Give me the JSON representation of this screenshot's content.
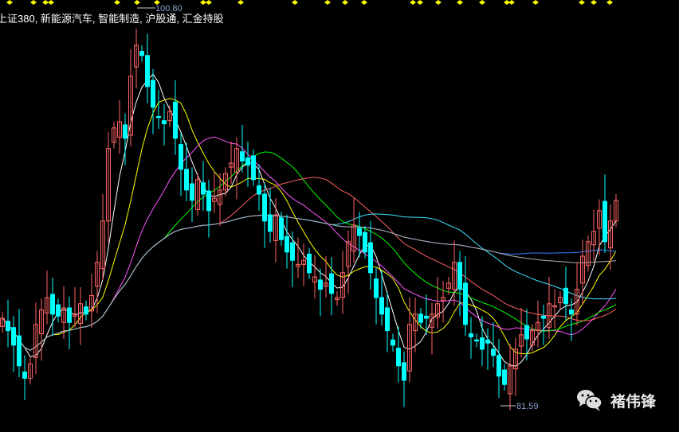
{
  "header": {
    "concepts": "上证380, 新能源汽车, 智能制造, 沪股通, 汇金持股"
  },
  "watermark": {
    "name": "褚伟锋",
    "icon": "wechat-icon"
  },
  "colors": {
    "up": "#ff6464",
    "down": "#00ffff",
    "background": "#000000",
    "marker": "#ffff00"
  },
  "chart_data": {
    "type": "candlestick",
    "title": "上证380, 新能源汽车, 智能制造, 沪股通, 汇金持股",
    "high_label": "100.80",
    "low_label": "81.59",
    "ylim": [
      81.0,
      101.2
    ],
    "close": [
      85.8,
      85.2,
      84.5,
      83.5,
      82.9,
      83.6,
      85.5,
      86.2,
      86.8,
      86.0,
      85.9,
      86.3,
      85.6,
      86.0,
      86.5,
      86.0,
      86.9,
      88.5,
      90.5,
      94.0,
      95.0,
      95.3,
      94.5,
      97.5,
      99.0,
      98.5,
      97.0,
      96.0,
      95.5,
      95.2,
      95.8,
      94.5,
      93.0,
      92.0,
      91.5,
      92.5,
      91.8,
      91.0,
      91.6,
      92.0,
      92.8,
      93.3,
      94.0,
      93.4,
      93.2,
      92.5,
      91.8,
      90.5,
      90.0,
      90.8,
      89.6,
      89.0,
      88.6,
      88.4,
      88.6,
      88.0,
      87.8,
      87.2,
      87.5,
      87.0,
      86.8,
      88.0,
      89.5,
      90.3,
      89.8,
      89.0,
      88.0,
      86.8,
      86.0,
      85.2,
      84.5,
      83.5,
      82.8,
      85.5,
      86.0,
      85.6,
      85.8,
      86.0,
      86.5,
      86.8,
      87.5,
      88.5,
      87.2,
      85.5,
      84.9,
      84.7,
      84.3,
      84.6,
      84.0,
      83.0,
      82.6,
      83.5,
      84.3,
      85.0,
      84.8,
      85.2,
      85.6,
      85.8,
      86.5,
      86.4,
      86.8,
      86.5,
      86.0,
      87.2,
      88.8,
      89.5,
      90.0,
      91.0,
      89.5,
      90.5,
      91.5
    ],
    "moving_averages": [
      {
        "period": 5,
        "color": "#ffffff"
      },
      {
        "period": 10,
        "color": "#ffff00"
      },
      {
        "period": 20,
        "color": "#ff55ff"
      },
      {
        "period": 30,
        "color": "#00ff00"
      },
      {
        "period": 40,
        "color": "#ff6060"
      },
      {
        "period": 60,
        "color": "#40e0ff"
      },
      {
        "period": 90,
        "color": "#3080ff"
      },
      {
        "period": 120,
        "color": "#b0b0b0"
      }
    ]
  }
}
